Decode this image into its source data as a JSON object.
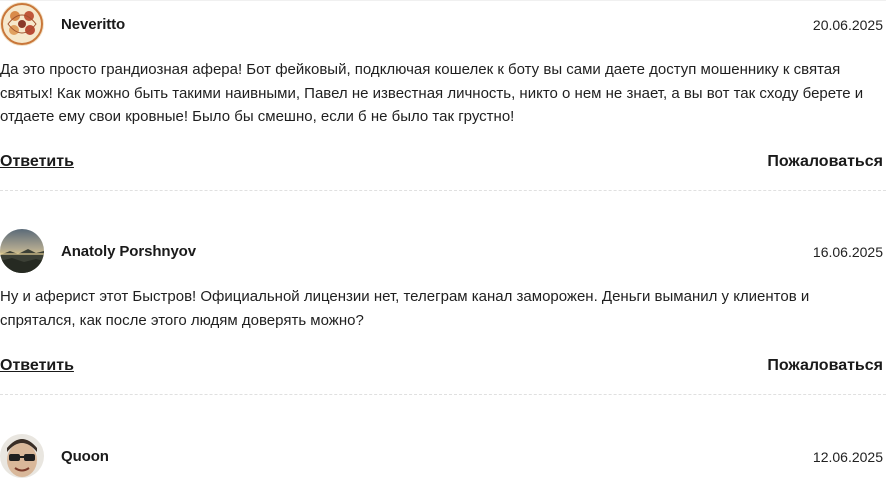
{
  "comments": [
    {
      "author": "Neveritto",
      "date": "20.06.2025",
      "lines": [
        "Да это просто грандиозная афера! Бот фейковый, подключая кошелек к боту вы сами даете доступ мошеннику к святая",
        "святых! Как можно быть такими наивными, Павел не известная личность, никто о нем не знает, а вы вот так сходу берете и",
        "отдаете ему свои кровные! Было бы смешно, если б не было так грустно!"
      ],
      "reply_label": "Ответить",
      "report_label": "Пожаловаться"
    },
    {
      "author": "Anatoly Porshnyov",
      "date": "16.06.2025",
      "lines": [
        "Ну и аферист этот Быстров! Официальной лицензии нет, телеграм канал заморожен. Деньги выманил у клиентов и",
        "спрятался, как после этого людям доверять можно?"
      ],
      "reply_label": "Ответить",
      "report_label": "Пожаловаться"
    },
    {
      "author": "Quoon",
      "date": "12.06.2025"
    }
  ]
}
